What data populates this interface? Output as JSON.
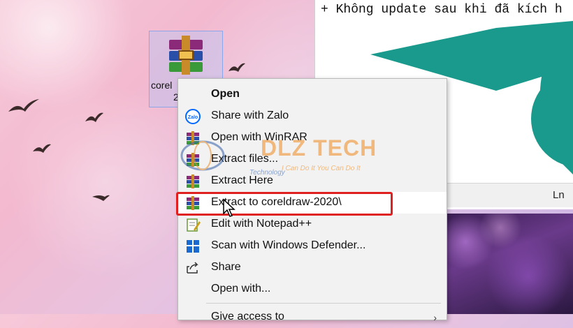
{
  "desktop": {
    "icon_label": "coreldraw-2020",
    "icon_label_visible_line1": "corel",
    "icon_label_visible_line2": "2"
  },
  "notepad": {
    "text_line": "+ Không update sau khi đã kích h",
    "status_label": "Ln"
  },
  "context_menu": {
    "items": [
      {
        "label": "Open",
        "icon": "none",
        "bold": true
      },
      {
        "label": "Share with Zalo",
        "icon": "zalo-icon"
      },
      {
        "label": "Open with WinRAR",
        "icon": "winrar-icon"
      },
      {
        "label": "Extract files...",
        "icon": "winrar-icon"
      },
      {
        "label": "Extract Here",
        "icon": "winrar-icon"
      },
      {
        "label": "Extract to coreldraw-2020\\",
        "icon": "winrar-icon",
        "highlighted": true
      },
      {
        "label": "Edit with Notepad++",
        "icon": "notepadpp-icon"
      },
      {
        "label": "Scan with Windows Defender...",
        "icon": "defender-icon"
      },
      {
        "label": "Share",
        "icon": "share-icon"
      },
      {
        "label": "Open with...",
        "icon": "none"
      },
      {
        "label": "Give access to",
        "icon": "none",
        "submenu": true
      }
    ]
  },
  "watermark": {
    "title": "DLZ TECH",
    "tagline": "I Can Do It You Can Do It",
    "sub": "Technology"
  },
  "colors": {
    "highlight_border": "#e02020",
    "teal": "#1a9a8c",
    "watermark": "#f08a1c"
  }
}
